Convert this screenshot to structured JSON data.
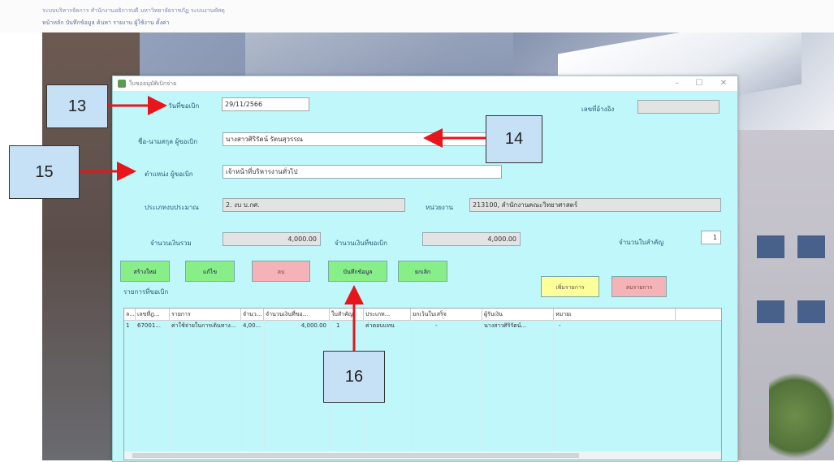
{
  "browser": {
    "line1": "ระบบบริหารจัดการ สำนักงานอธิการบดี มหาวิทยาลัยราชภัฏ ระบบงานพัสดุ",
    "line2": "หน้าหลัก  บันทึกข้อมูล  ค้นหา  รายงาน  ผู้ใช้งาน  ตั้งค่า"
  },
  "window": {
    "title": "ใบขออนุมัติเบิกจ่าย",
    "minimize": "–",
    "maximize": "☐",
    "close": "✕"
  },
  "form": {
    "date_label": "วันที่ขอเบิก",
    "date_value": "29/11/2566",
    "doc_no_label": "เลขที่อ้างอิง",
    "doc_no_value": "",
    "requester_label": "ชื่อ-นามสกุล ผู้ขอเบิก",
    "requester_value": "นางสาวศิริรัตน์ รัตนสุวรรณ",
    "position_label": "ตำแหน่ง ผู้ขอเบิก",
    "position_value": "เจ้าหน้าที่บริหารงานทั่วไป",
    "budget_type_label": "ประเภทงบประมาณ",
    "budget_type_value": "2. งบ บ.กศ.",
    "unit_label": "หน่วยงาน",
    "unit_value": "213100, สำนักงานคณะวิทยาศาสตร์",
    "total_label": "จำนวนเงินรวม",
    "total_value": "4,000.00",
    "approved_label": "จำนวนเงินที่ขอเบิก",
    "approved_value": "4,000.00",
    "attach_label": "จำนวนใบสำคัญ",
    "attach_value": "1",
    "list_label": "รายการที่ขอเบิก"
  },
  "buttons": {
    "new": "สร้างใหม่",
    "edit": "แก้ไข",
    "delete": "ลบ",
    "save": "บันทึกข้อมูล",
    "cancel": "ยกเลิก",
    "add_item": "เพิ่มรายการ",
    "remove_item": "ลบรายการ"
  },
  "table": {
    "columns": [
      "ล...",
      "เลขที่ฎ...",
      "รายการ",
      "จำนว...",
      "จำนวนเงินที่ขอ...",
      "ใบสำคัญ",
      "ประเภท...",
      "ยกเว้นใบเสร็จ",
      "ผู้รับเงิน",
      "หมายเ"
    ],
    "rows": [
      [
        "1",
        "67001...",
        "ค่าใช้จ่ายในการเดินทาง...",
        "4,00...",
        "4,000.00",
        "1",
        "ค่าตอบแทน",
        "-",
        "นางสาวศิริรัตน์...",
        "-"
      ]
    ]
  },
  "callouts": {
    "c13": "13",
    "c14": "14",
    "c15": "15",
    "c16": "16"
  },
  "colors": {
    "window_bg": "#bff7fb",
    "button_green": "#88ee88",
    "button_pink": "#f5b3b8",
    "button_yellow": "#ffff99",
    "callout_bg": "#c6e0f5",
    "arrow": "#e8151b"
  }
}
